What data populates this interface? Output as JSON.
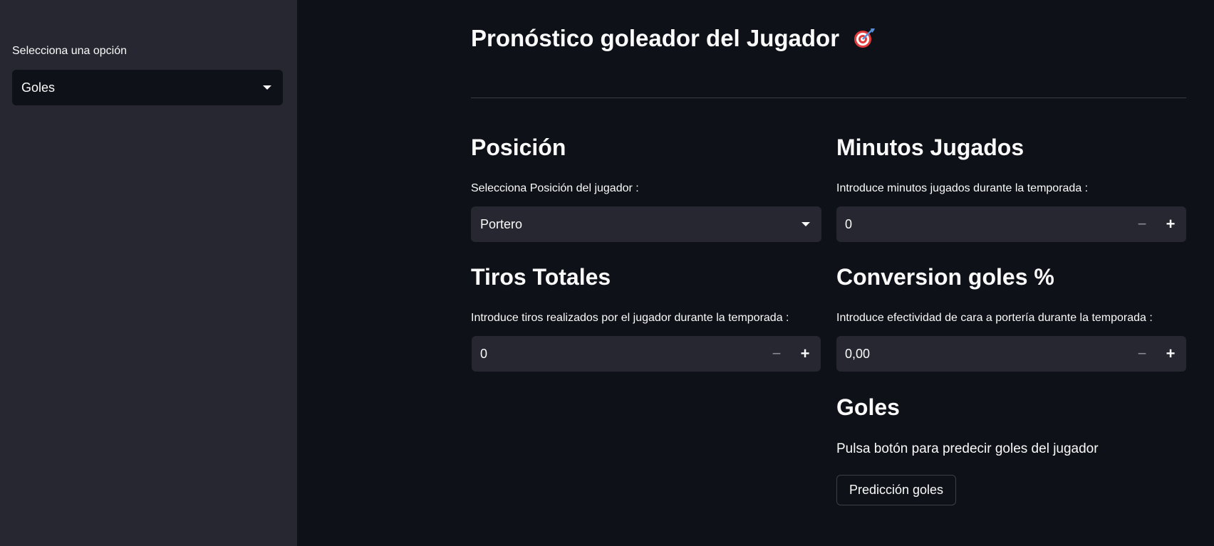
{
  "sidebar": {
    "label": "Selecciona una opción",
    "selected": "Goles"
  },
  "main": {
    "title": "Pronóstico goleador del Jugador",
    "posicion": {
      "heading": "Posición",
      "label": "Selecciona Posición del jugador :",
      "selected": "Portero"
    },
    "minutos": {
      "heading": "Minutos Jugados",
      "label": "Introduce minutos jugados durante la temporada :",
      "value": "0"
    },
    "tiros": {
      "heading": "Tiros Totales",
      "label": "Introduce tiros realizados por el jugador durante la temporada :",
      "value": "0"
    },
    "conversion": {
      "heading": "Conversion goles %",
      "label": "Introduce efectividad de cara a portería durante la temporada :",
      "value": "0,00"
    },
    "goles": {
      "heading": "Goles",
      "text": "Pulsa botón para predecir goles del jugador",
      "button": "Predicción goles"
    },
    "stepper": {
      "minus": "−",
      "plus": "+"
    }
  },
  "colors": {
    "background": "#0e1117",
    "sidebar": "#262730",
    "input": "#262730",
    "text": "#fafafa"
  }
}
